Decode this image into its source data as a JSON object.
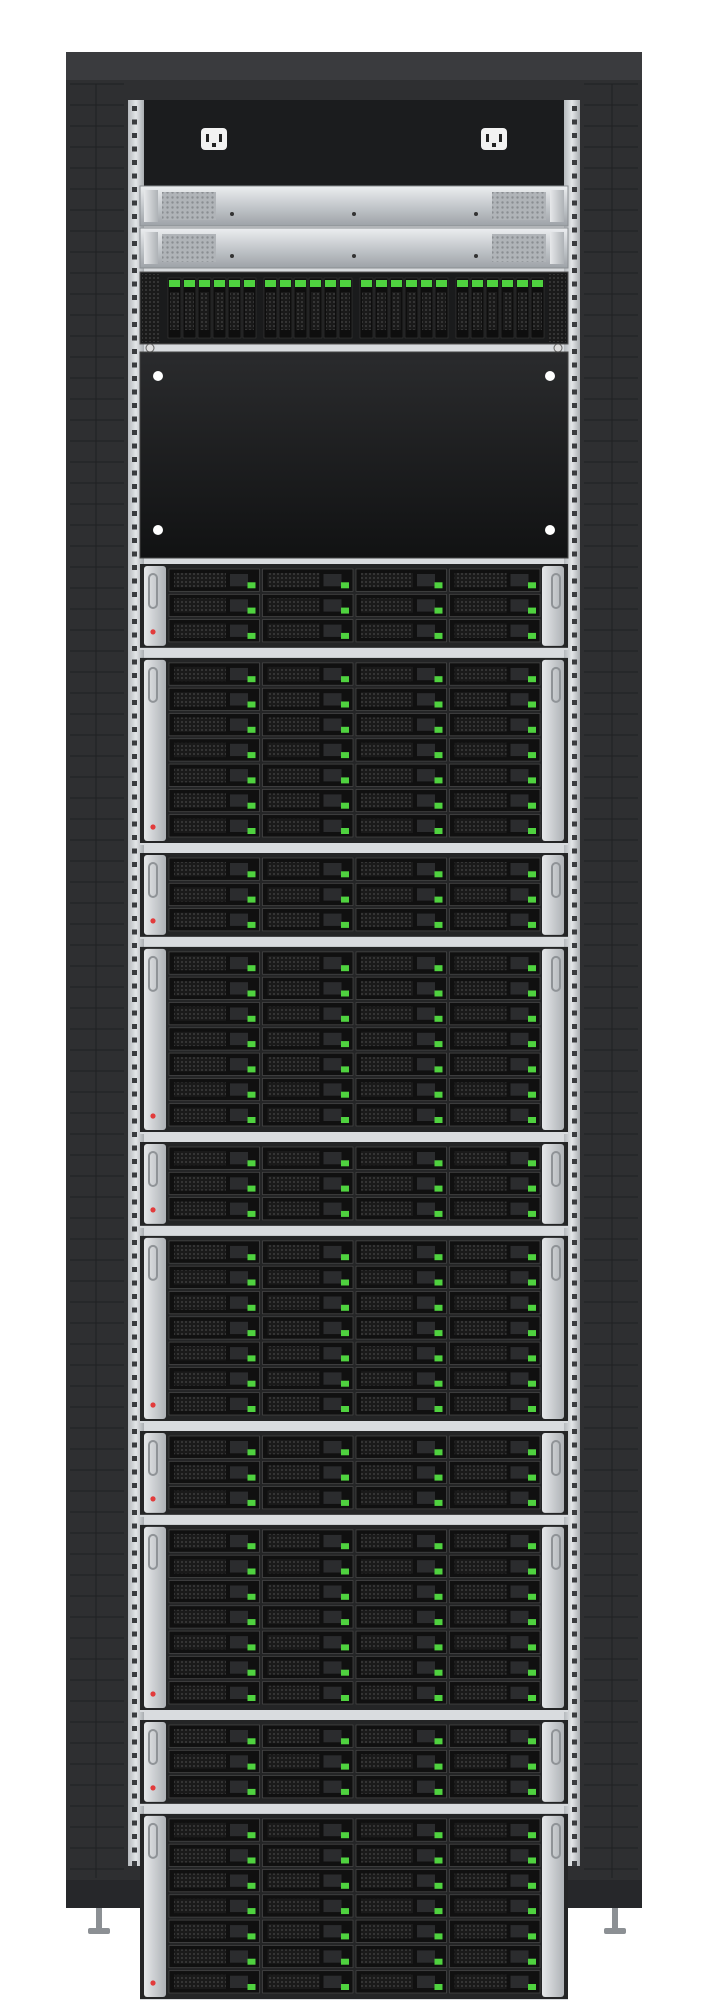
{
  "rack": {
    "pdu": {
      "outlets": 2
    },
    "top_units": [
      {
        "kind": "switch",
        "vents": 2
      },
      {
        "kind": "switch",
        "vents": 2
      },
      {
        "kind": "drive-array",
        "groups": 4,
        "drives_per_group": 6
      }
    ],
    "blank_panel": {
      "screws": 4
    },
    "enclosures": [
      {
        "rows": 3
      },
      {
        "rows": 7
      },
      {
        "rows": 3
      },
      {
        "rows": 7
      },
      {
        "rows": 3
      },
      {
        "rows": 7
      },
      {
        "rows": 3
      },
      {
        "rows": 7
      },
      {
        "rows": 3
      },
      {
        "rows": 7
      }
    ],
    "drives_per_row": 4,
    "colors": {
      "frame": "#2e2f31",
      "frame_dark": "#1d1e20",
      "rail": "#c9cdd1",
      "rail_hole": "#3a3c3f",
      "switch": "#c7cacd",
      "drive_bay": "#141414",
      "led_green": "#4fd23f",
      "led_red": "#e23b3b"
    }
  }
}
